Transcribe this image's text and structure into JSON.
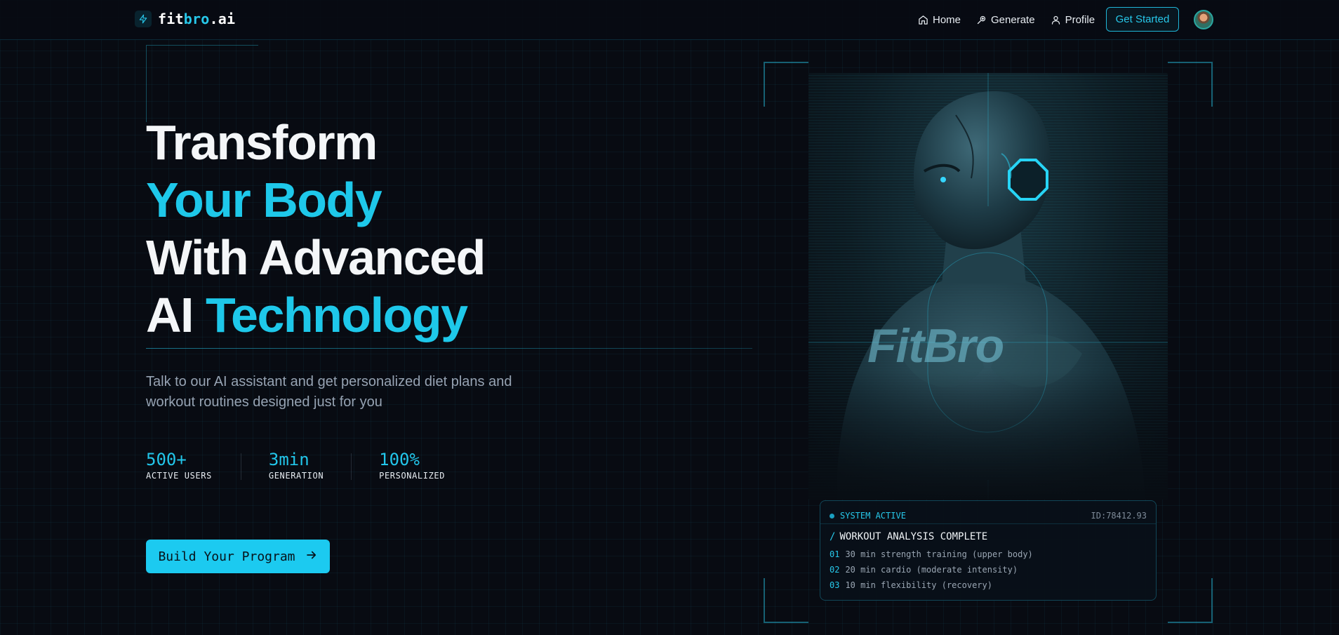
{
  "nav": {
    "logo": {
      "part1": "fit",
      "part2": "bro",
      "part3": ".ai"
    },
    "links": [
      {
        "label": "Home",
        "icon": "home-icon"
      },
      {
        "label": "Generate",
        "icon": "zap-icon"
      },
      {
        "label": "Profile",
        "icon": "user-icon"
      }
    ],
    "cta_label": "Get Started"
  },
  "hero": {
    "title": {
      "line1": "Transform",
      "line2": "Your Body",
      "line3": "With Advanced",
      "line4_white": "AI ",
      "line4_cyan": "Technology"
    },
    "subtitle": "Talk to our AI assistant and get personalized diet plans and workout routines designed just for you",
    "stats": [
      {
        "value": "500+",
        "label": "ACTIVE USERS"
      },
      {
        "value": "3min",
        "label": "GENERATION"
      },
      {
        "value": "100%",
        "label": "PERSONALIZED"
      }
    ],
    "cta_label": "Build Your Program"
  },
  "visual": {
    "watermark": "FitBro",
    "status_card": {
      "status": "SYSTEM ACTIVE",
      "id": "ID:78412.93",
      "title": "WORKOUT ANALYSIS COMPLETE",
      "items": [
        {
          "num": "01",
          "text": "30 min strength training (upper body)"
        },
        {
          "num": "02",
          "text": "20 min cardio (moderate intensity)"
        },
        {
          "num": "03",
          "text": "10 min flexibility (recovery)"
        }
      ]
    }
  },
  "colors": {
    "accent": "#1ec8ea",
    "background": "#080b12",
    "text": "#f4f6f8",
    "muted": "#96a3b3"
  }
}
